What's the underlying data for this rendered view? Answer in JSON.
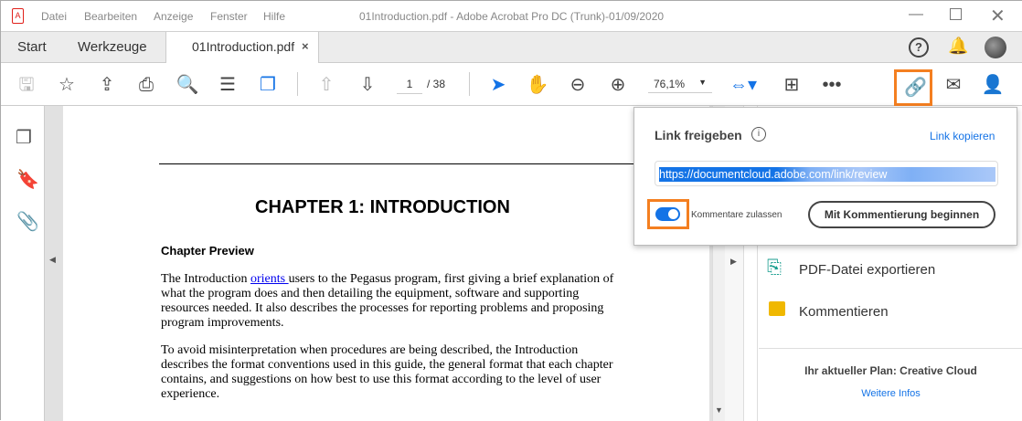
{
  "titlebar": {
    "menu": [
      "Datei",
      "Bearbeiten",
      "Anzeige",
      "Fenster",
      "Hilfe"
    ],
    "title": "01Introduction.pdf - Adobe Acrobat Pro DC (Trunk)-01/09/2020"
  },
  "tabs": {
    "start": "Start",
    "tools": "Werkzeuge",
    "document": "01Introduction.pdf",
    "close": "×"
  },
  "toolbar": {
    "page_current": "1",
    "page_total": "/ 38",
    "zoom": "76,1%"
  },
  "document": {
    "chapter_title": "CHAPTER 1:  INTRODUCTION",
    "section_title": "Chapter Preview",
    "para1_prefix": "The Introduction ",
    "para1_link": "orients ",
    "para1_lines": [
      "users to the Pegasus program, first giving a brief explanation of",
      "what the program does and then detailing the equipment, software and supporting",
      "resources needed.  It also describes the processes for reporting problems and proposing",
      "program improvements."
    ],
    "para2_lines": [
      "To avoid misinterpretation when procedures are being described, the Introduction",
      "describes the format conventions used in this guide, the general format that each chapter",
      "contains, and suggestions on how best to use this format according to the level of user",
      "experience."
    ]
  },
  "share_popup": {
    "title": "Link freigeben",
    "copy_link": "Link kopieren",
    "url": "https://documentcloud.adobe.com/link/review",
    "toggle_label": "Kommentare zulassen",
    "toggle_on": true,
    "start_button": "Mit Kommentierung beginnen"
  },
  "right_panel": {
    "items": [
      "PDF-Datei exportieren",
      "Kommentieren"
    ],
    "plan": "Ihr aktueller Plan: Creative Cloud",
    "more_info": "Weitere Infos"
  },
  "colors": {
    "accent": "#1473e6",
    "highlight": "#f47f20"
  }
}
